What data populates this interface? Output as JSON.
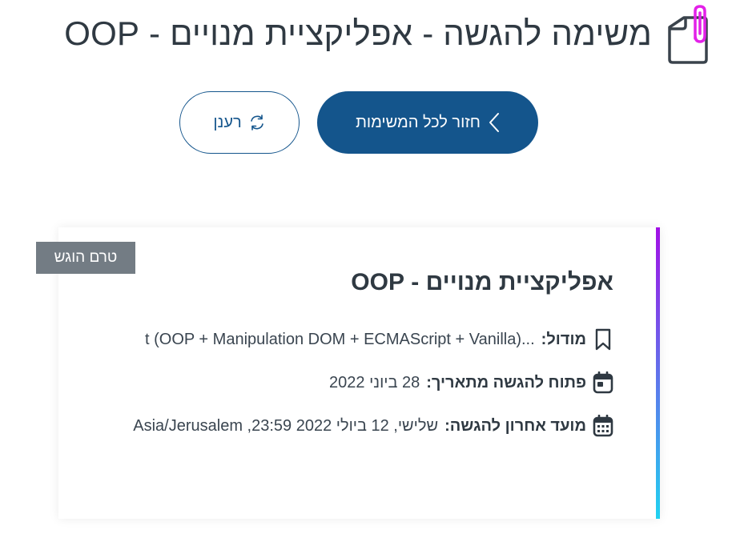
{
  "header": {
    "title": "משימה להגשה - אפליקציית מנויים - OOP",
    "icon": "paperclip-document-icon"
  },
  "actions": {
    "back_label": "חזור לכל המשימות",
    "back_icon": "chevron-left-icon",
    "refresh_label": "רענן",
    "refresh_icon": "refresh-icon"
  },
  "card": {
    "status_badge": "טרם הוגש",
    "title": "אפליקציית מנויים - OOP",
    "module_label": "מודול:",
    "module_value": "...t (OOP + Manipulation DOM + ECMAScript + Vanilla)",
    "open_label": "פתוח להגשה מתאריך:",
    "open_value": "28 ביוני 2022",
    "deadline_label": "מועד אחרון להגשה:",
    "deadline_value": "שלישי, 12 ביולי 2022 23:59, Asia/Jerusalem"
  },
  "colors": {
    "primary": "#14558c",
    "badge": "#737c84",
    "accent_top": "#a210e6",
    "accent_bottom": "#20d2f0",
    "paperclip": "#e321e8"
  }
}
